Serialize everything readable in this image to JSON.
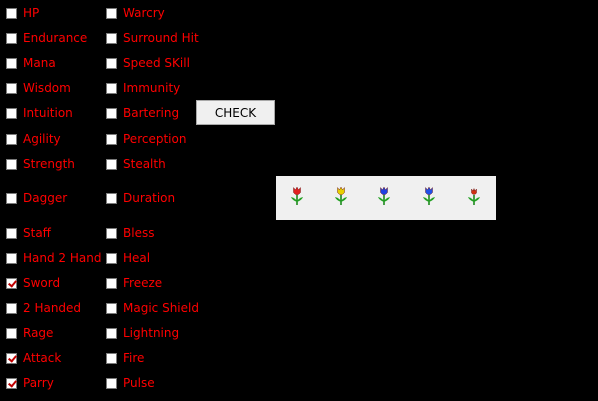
{
  "left_column": [
    {
      "label": "HP",
      "checked": false
    },
    {
      "label": "Endurance",
      "checked": false
    },
    {
      "label": "Mana",
      "checked": false
    },
    {
      "label": "Wisdom",
      "checked": false
    },
    {
      "label": "Intuition",
      "checked": false
    },
    {
      "label": "Agility",
      "checked": false
    },
    {
      "label": "Strength",
      "checked": false
    },
    {
      "label": "Dagger",
      "checked": false
    },
    {
      "label": "Staff",
      "checked": false
    },
    {
      "label": "Hand 2 Hand",
      "checked": false
    },
    {
      "label": "Sword",
      "checked": true
    },
    {
      "label": "2 Handed",
      "checked": false
    },
    {
      "label": "Rage",
      "checked": false
    },
    {
      "label": "Attack",
      "checked": true
    },
    {
      "label": "Parry",
      "checked": true
    }
  ],
  "right_column": [
    {
      "label": "Warcry",
      "checked": false
    },
    {
      "label": "Surround Hit",
      "checked": false
    },
    {
      "label": "Speed SKill",
      "checked": false
    },
    {
      "label": "Immunity",
      "checked": false
    },
    {
      "label": "Bartering",
      "checked": false
    },
    {
      "label": "Perception",
      "checked": false
    },
    {
      "label": "Stealth",
      "checked": false
    },
    {
      "label": "Duration",
      "checked": false
    },
    {
      "label": "Bless",
      "checked": false
    },
    {
      "label": "Heal",
      "checked": false
    },
    {
      "label": "Freeze",
      "checked": false
    },
    {
      "label": "Magic Shield",
      "checked": false
    },
    {
      "label": "Lightning",
      "checked": false
    },
    {
      "label": "Fire",
      "checked": false
    },
    {
      "label": "Pulse",
      "checked": false
    }
  ],
  "check_button": {
    "label": "CHECK"
  },
  "flowers": [
    {
      "icon": "red-flower-icon",
      "color": "#e02020"
    },
    {
      "icon": "yellow-flower-icon",
      "color": "#e8d000"
    },
    {
      "icon": "blue-flower-icon",
      "color": "#2040e0"
    },
    {
      "icon": "blue-flower-icon",
      "color": "#2050e8"
    },
    {
      "icon": "small-red-flower-icon",
      "color": "#d03010"
    }
  ],
  "colors": {
    "background": "#000000",
    "label": "#ff0000",
    "panel": "#f0f0f0"
  }
}
